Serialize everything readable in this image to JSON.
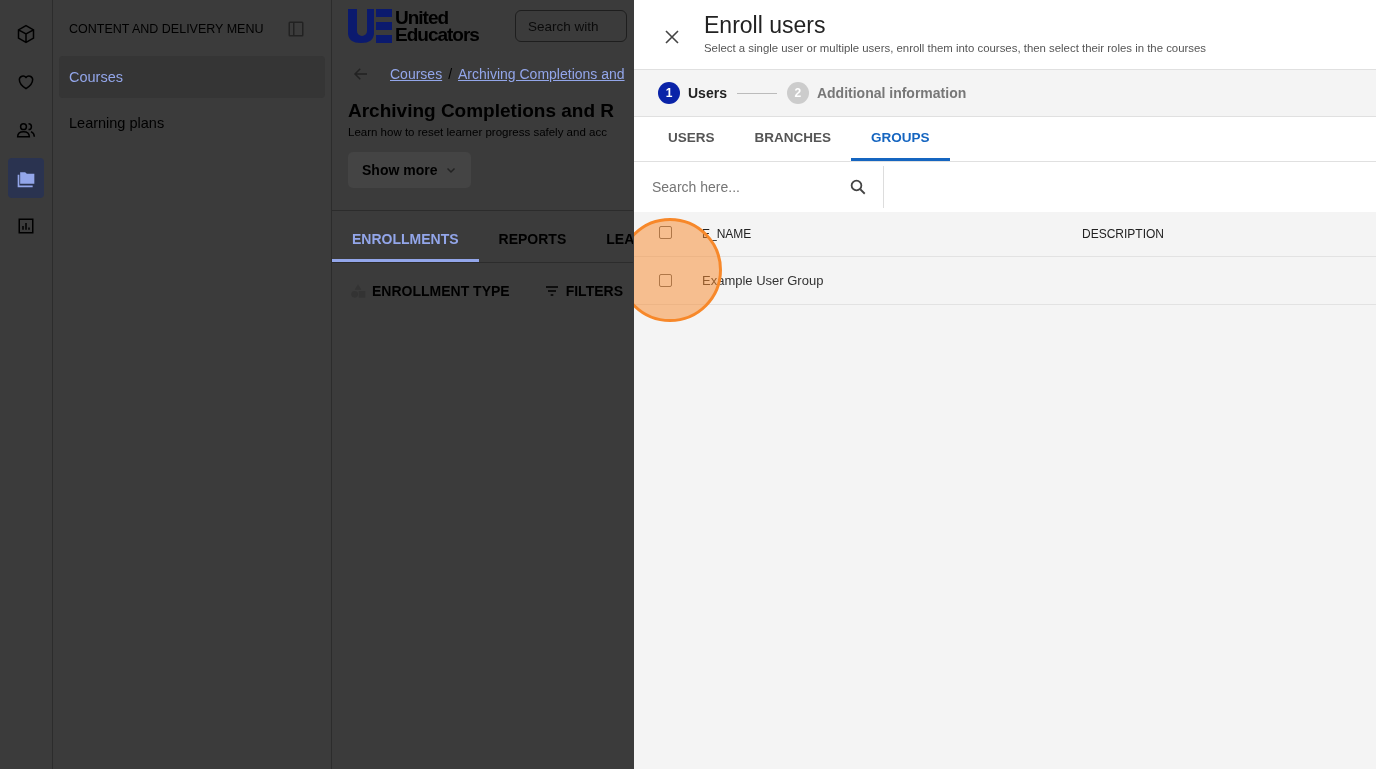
{
  "rail": {
    "items": [
      {
        "kind": "cube",
        "selected": false
      },
      {
        "kind": "heart",
        "selected": false
      },
      {
        "kind": "people",
        "selected": false
      },
      {
        "kind": "folders",
        "selected": true
      },
      {
        "kind": "chart",
        "selected": false
      }
    ]
  },
  "nav": {
    "title": "CONTENT AND DELIVERY MENU",
    "items": [
      {
        "label": "Courses",
        "selected": true
      },
      {
        "label": "Learning plans",
        "selected": false
      }
    ]
  },
  "main": {
    "logo": {
      "line1": "United",
      "line2": "Educators"
    },
    "search": {
      "placeholder": "Search with"
    },
    "breadcrumb": [
      "Courses",
      "Archiving Completions and"
    ],
    "breadcrumb_separator": "/",
    "title": "Archiving Completions and R",
    "subtitle": "Learn how to reset learner progress safely and acc",
    "show_more": "Show more",
    "tabs": [
      {
        "label": "ENROLLMENTS",
        "selected": true
      },
      {
        "label": "REPORTS",
        "selected": false
      },
      {
        "label": "LEA",
        "selected": false
      }
    ],
    "toolbar": [
      {
        "kind": "shapes",
        "label": "ENROLLMENT TYPE"
      },
      {
        "kind": "filter",
        "label": "FILTERS"
      }
    ]
  },
  "drawer": {
    "title": "Enroll users",
    "subtitle": "Select a single user or multiple users, enroll them into courses, then select their roles in the courses",
    "steps": [
      {
        "number": "1",
        "label": "Users",
        "selected": true
      },
      {
        "number": "2",
        "label": "Additional information",
        "selected": false
      }
    ],
    "tabs": [
      {
        "label": "USERS",
        "selected": false
      },
      {
        "label": "BRANCHES",
        "selected": false
      },
      {
        "label": "GROUPS",
        "selected": true
      }
    ],
    "search": {
      "placeholder": "Search here..."
    },
    "table": {
      "columns": [
        "E_NAME",
        "DESCRIPTION"
      ],
      "all_checked": false,
      "rows": [
        {
          "name": "Example User Group",
          "checked": false
        }
      ]
    }
  }
}
